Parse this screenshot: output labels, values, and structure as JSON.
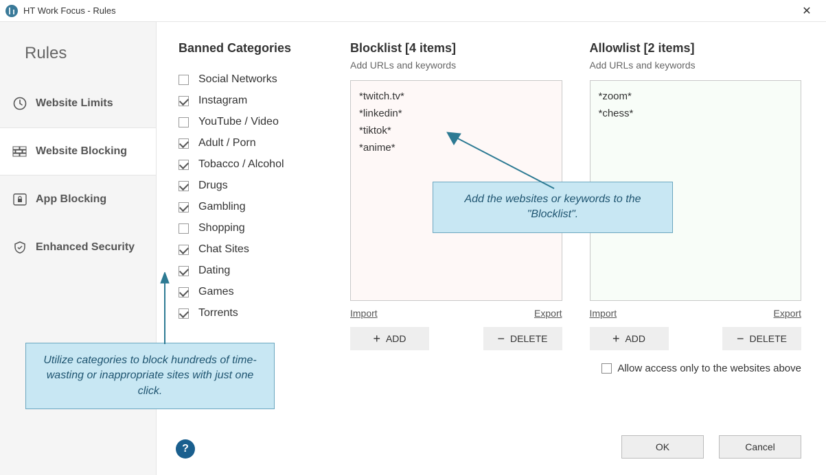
{
  "window": {
    "title": "HT Work Focus - Rules",
    "close": "✕"
  },
  "sidebar": {
    "heading": "Rules",
    "items": [
      {
        "label": "Website Limits",
        "icon": "clock",
        "active": false
      },
      {
        "label": "Website Blocking",
        "icon": "wall",
        "active": true
      },
      {
        "label": "App Blocking",
        "icon": "lock",
        "active": false
      },
      {
        "label": "Enhanced Security",
        "icon": "shield",
        "active": false
      }
    ]
  },
  "categories": {
    "title": "Banned Categories",
    "items": [
      {
        "label": "Social Networks",
        "checked": false
      },
      {
        "label": "Instagram",
        "checked": true
      },
      {
        "label": "YouTube / Video",
        "checked": false
      },
      {
        "label": "Adult / Porn",
        "checked": true
      },
      {
        "label": "Tobacco / Alcohol",
        "checked": true
      },
      {
        "label": "Drugs",
        "checked": true
      },
      {
        "label": "Gambling",
        "checked": true
      },
      {
        "label": "Shopping",
        "checked": false
      },
      {
        "label": "Chat Sites",
        "checked": true
      },
      {
        "label": "Dating",
        "checked": true
      },
      {
        "label": "Games",
        "checked": true
      },
      {
        "label": "Torrents",
        "checked": true
      }
    ]
  },
  "blocklist": {
    "title": "Blocklist [4 items]",
    "subtitle": "Add URLs and keywords",
    "items": [
      "*twitch.tv*",
      "*linkedin*",
      "*tiktok*",
      "*anime*"
    ],
    "import": "Import",
    "export": "Export",
    "add": "ADD",
    "delete": "DELETE"
  },
  "allowlist": {
    "title": "Allowlist [2 items]",
    "subtitle": "Add URLs and keywords",
    "items": [
      "*zoom*",
      "*chess*"
    ],
    "import": "Import",
    "export": "Export",
    "add": "ADD",
    "delete": "DELETE"
  },
  "allow_only_label": "Allow access only to the websites above",
  "buttons": {
    "ok": "OK",
    "cancel": "Cancel",
    "help": "?"
  },
  "callouts": {
    "categories": "Utilize categories to block hundreds of time-wasting or inappropriate sites with just one click.",
    "blocklist": "Add the websites or keywords to the \"Blocklist\"."
  }
}
